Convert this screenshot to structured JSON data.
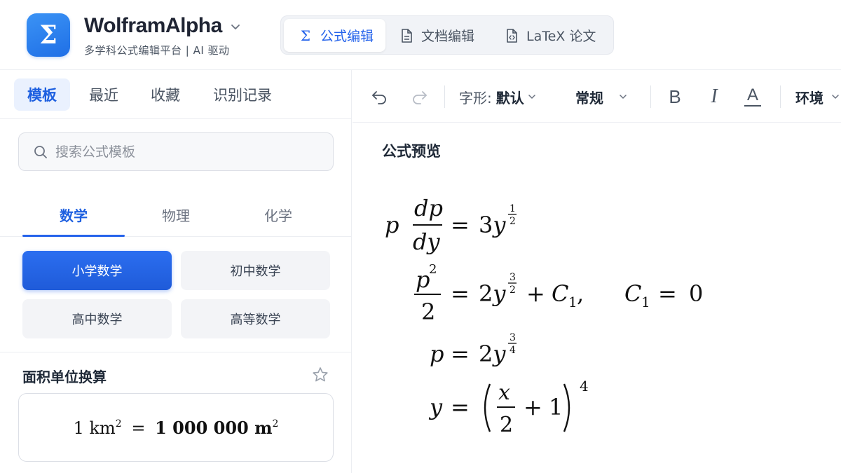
{
  "header": {
    "brand_name": "WolframAlpha",
    "brand_subtitle": "多学科公式编辑平台 | AI 驱动",
    "logo_glyph": "Σ",
    "mode_tabs": [
      {
        "label": "公式编辑",
        "icon": "sigma-icon",
        "active": true
      },
      {
        "label": "文档编辑",
        "icon": "document-icon",
        "active": false
      },
      {
        "label": "LaTeX 论文",
        "icon": "code-file-icon",
        "active": false
      }
    ]
  },
  "sidebar": {
    "tabs": [
      {
        "label": "模板",
        "active": true
      },
      {
        "label": "最近",
        "active": false
      },
      {
        "label": "收藏",
        "active": false
      },
      {
        "label": "识别记录",
        "active": false
      }
    ],
    "search_placeholder": "搜索公式模板",
    "subjects": [
      {
        "label": "数学",
        "active": true
      },
      {
        "label": "物理",
        "active": false
      },
      {
        "label": "化学",
        "active": false
      }
    ],
    "grades": [
      {
        "label": "小学数学",
        "active": true
      },
      {
        "label": "初中数学",
        "active": false
      },
      {
        "label": "高中数学",
        "active": false
      },
      {
        "label": "高等数学",
        "active": false
      }
    ],
    "template_card": {
      "title": "面积单位换算",
      "formula_lhs": "1 km",
      "formula_lhs_exp": "2",
      "formula_eq": "=",
      "formula_rhs": "1 000 000 m",
      "formula_rhs_exp": "2"
    }
  },
  "toolbar": {
    "font_label": "字形:",
    "font_value": "默认",
    "weight_value": "常规",
    "bold_label": "B",
    "italic_label": "I",
    "color_label": "A",
    "env_label": "环境"
  },
  "preview": {
    "title": "公式预览",
    "lines": [
      "p dp/dy = 3y^(1/2)",
      "p^2/2 = 2y^(3/2) + C_1,  C_1 = 0",
      "p = 2y^(3/4)",
      "y = (x/2 + 1)^4"
    ]
  },
  "colors": {
    "accent": "#2563eb",
    "logo_gradient_top": "#3b93f5",
    "logo_gradient_bottom": "#1f6fe6"
  }
}
